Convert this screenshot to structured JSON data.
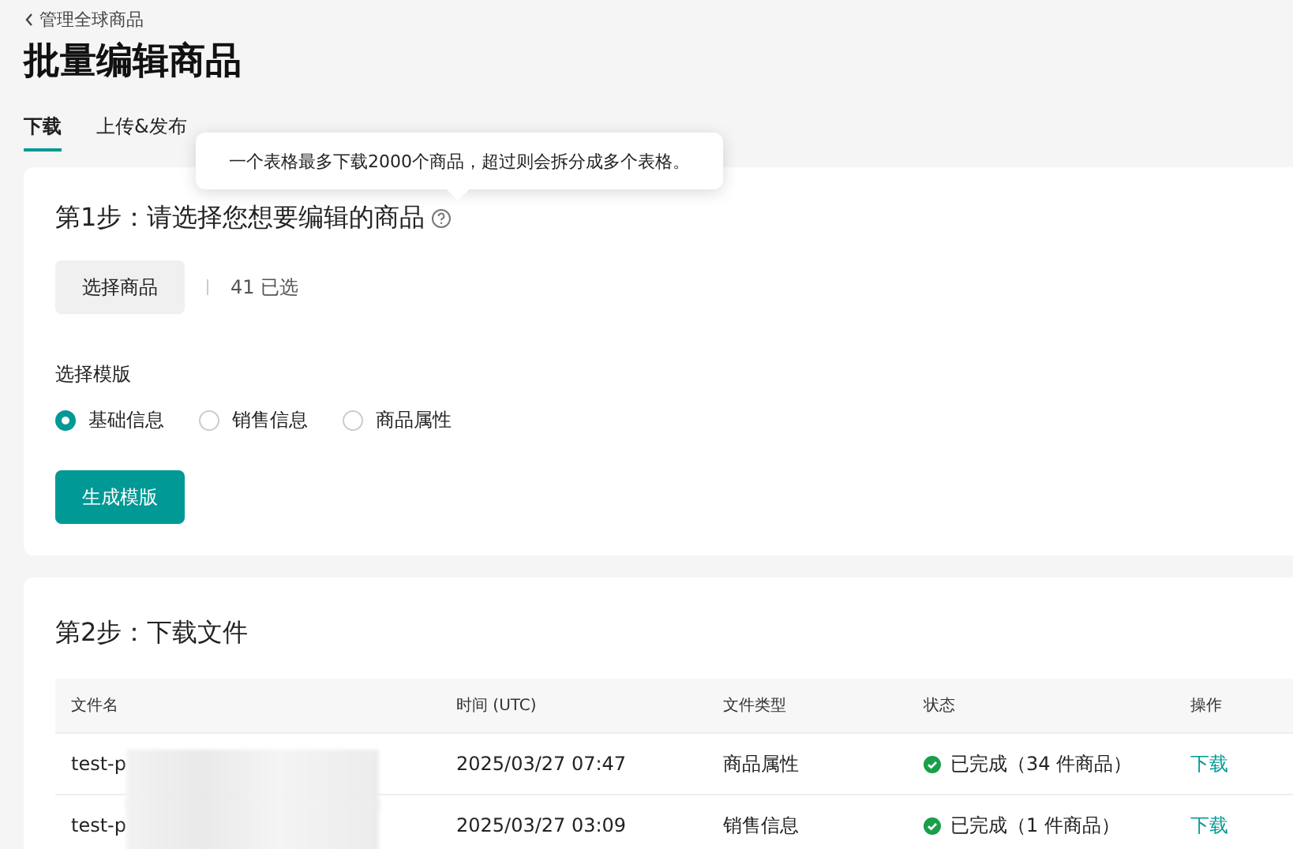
{
  "back_link": "管理全球商品",
  "title": "批量编辑商品",
  "tabs": [
    {
      "label": "下载",
      "selected": true
    },
    {
      "label": "上传&发布",
      "selected": false
    }
  ],
  "tooltip": "一个表格最多下载2000个商品，超过则会拆分成多个表格。",
  "step1": {
    "heading": "第1步：请选择您想要编辑的商品",
    "select_button": "选择商品",
    "selected_count": "41 已选",
    "template_label": "选择模版",
    "templates": [
      {
        "label": "基础信息",
        "selected": true
      },
      {
        "label": "销售信息",
        "selected": false
      },
      {
        "label": "商品属性",
        "selected": false
      }
    ],
    "generate_button": "生成模版"
  },
  "step2": {
    "heading": "第2步：下载文件",
    "table": {
      "columns": [
        "文件名",
        "时间 (UTC)",
        "文件类型",
        "状态",
        "操作"
      ],
      "rows": [
        {
          "file": "test-p",
          "time": "2025/03/27 07:47",
          "type": "商品属性",
          "status": "已完成（34 件商品）",
          "action": "下载"
        },
        {
          "file": "test-p",
          "time": "2025/03/27 03:09",
          "type": "销售信息",
          "status": "已完成（1 件商品）",
          "action": "下载"
        }
      ]
    }
  }
}
